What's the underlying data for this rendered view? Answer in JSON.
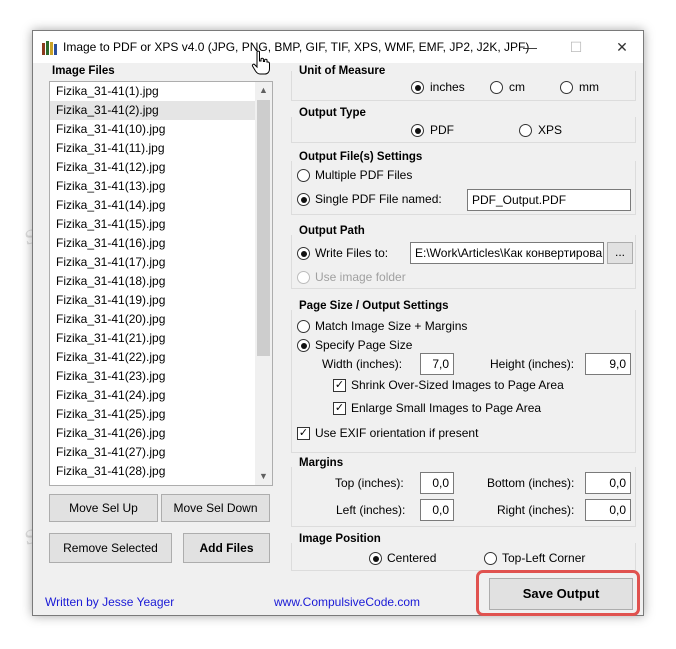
{
  "window": {
    "title": "Image to PDF or XPS  v4.0   (JPG, PNG, BMP, GIF, TIF, XPS, WMF, EMF, JP2, J2K, JPF)",
    "minimize_glyph": "—",
    "maximize_glyph": "☐",
    "close_glyph": "✕"
  },
  "image_files": {
    "label": "Image Files",
    "items": [
      "Fizika_31-41(1).jpg",
      "Fizika_31-41(2).jpg",
      "Fizika_31-41(10).jpg",
      "Fizika_31-41(11).jpg",
      "Fizika_31-41(12).jpg",
      "Fizika_31-41(13).jpg",
      "Fizika_31-41(14).jpg",
      "Fizika_31-41(15).jpg",
      "Fizika_31-41(16).jpg",
      "Fizika_31-41(17).jpg",
      "Fizika_31-41(18).jpg",
      "Fizika_31-41(19).jpg",
      "Fizika_31-41(20).jpg",
      "Fizika_31-41(21).jpg",
      "Fizika_31-41(22).jpg",
      "Fizika_31-41(23).jpg",
      "Fizika_31-41(24).jpg",
      "Fizika_31-41(25).jpg",
      "Fizika_31-41(26).jpg",
      "Fizika_31-41(27).jpg",
      "Fizika_31-41(28).jpg"
    ],
    "selected_index": 1,
    "move_up": "Move Sel Up",
    "move_down": "Move Sel Down",
    "remove": "Remove Selected",
    "add": "Add Files"
  },
  "unit": {
    "title": "Unit of Measure",
    "inches": "inches",
    "cm": "cm",
    "mm": "mm",
    "selected": "inches"
  },
  "output_type": {
    "title": "Output Type",
    "pdf": "PDF",
    "xps": "XPS",
    "selected": "PDF"
  },
  "output_files": {
    "title": "Output File(s) Settings",
    "multiple": "Multiple PDF Files",
    "single": "Single PDF File named:",
    "filename": "PDF_Output.PDF"
  },
  "output_path": {
    "title": "Output Path",
    "write_to": "Write Files to:",
    "path": "E:\\Work\\Articles\\Как конвертирова",
    "browse": "...",
    "use_image_folder": "Use image folder"
  },
  "page_size": {
    "title": "Page Size / Output Settings",
    "match": "Match Image Size + Margins",
    "specify": "Specify Page Size",
    "width_label": "Width (inches):",
    "width": "7,0",
    "height_label": "Height (inches):",
    "height": "9,0",
    "shrink": "Shrink Over-Sized Images to Page Area",
    "enlarge": "Enlarge Small Images to Page Area",
    "exif": "Use EXIF orientation if present"
  },
  "margins": {
    "title": "Margins",
    "top_label": "Top (inches):",
    "top": "0,0",
    "bottom_label": "Bottom (inches):",
    "bottom": "0,0",
    "left_label": "Left (inches):",
    "left": "0,0",
    "right_label": "Right (inches):",
    "right": "0,0"
  },
  "image_position": {
    "title": "Image Position",
    "centered": "Centered",
    "top_left": "Top-Left Corner",
    "selected": "Centered"
  },
  "save_output": "Save Output",
  "footer": {
    "author": "Written by Jesse Yeager",
    "site": "www.CompulsiveCode.com"
  },
  "watermark": "Sorting-repair.com",
  "colors": {
    "link": "#1a1ad6",
    "highlight": "#e0524f"
  }
}
